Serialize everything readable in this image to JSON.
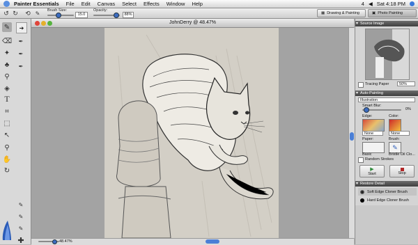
{
  "menubar": {
    "app_name": "Painter Essentials",
    "items": [
      "File",
      "Edit",
      "Canvas",
      "Select",
      "Effects",
      "Window",
      "Help"
    ],
    "badge": "4",
    "clock": "Sat 4:18 PM"
  },
  "propbar": {
    "brush_size_label": "Brush Size:",
    "brush_size_value": "15.0",
    "opacity_label": "Opacity:",
    "opacity_value": "88%",
    "layout_buttons": [
      "Drawing & Painting",
      "Photo Painting"
    ]
  },
  "document": {
    "title": "JohnDerry @ 48.47%",
    "zoom": "48.47%"
  },
  "source_image": {
    "header": "Source Image",
    "tracing_paper_label": "Tracing Paper",
    "tracing_paper_value": "50%"
  },
  "auto_painting": {
    "header": "Auto-Painting",
    "style": "Illustration",
    "smart_blur_label": "Smart Blur:",
    "smart_blur_value": "0%",
    "edge_label": "Edge:",
    "edge_value": "None",
    "color_label": "Color:",
    "color_value": "None",
    "paper_label": "Paper:",
    "paper_value": "Basic",
    "brush_label": "Brush:",
    "brush_value": "Bristle Oil Clo...",
    "random_strokes_label": "Random Strokes",
    "start_label": "Start",
    "stop_label": "Stop"
  },
  "restore_detail": {
    "header": "Restore Detail",
    "items": [
      "Soft Edge Cloner Brush",
      "Hard Edge Cloner Brush"
    ]
  },
  "colors": {
    "accent": "#3c6cc0",
    "paper": "#d3cfc6",
    "close_light": "#e0443a",
    "min_light": "#e5b02b",
    "zoom_light": "#56b33e",
    "start": "#2e8b3a",
    "stop": "#b22626"
  }
}
